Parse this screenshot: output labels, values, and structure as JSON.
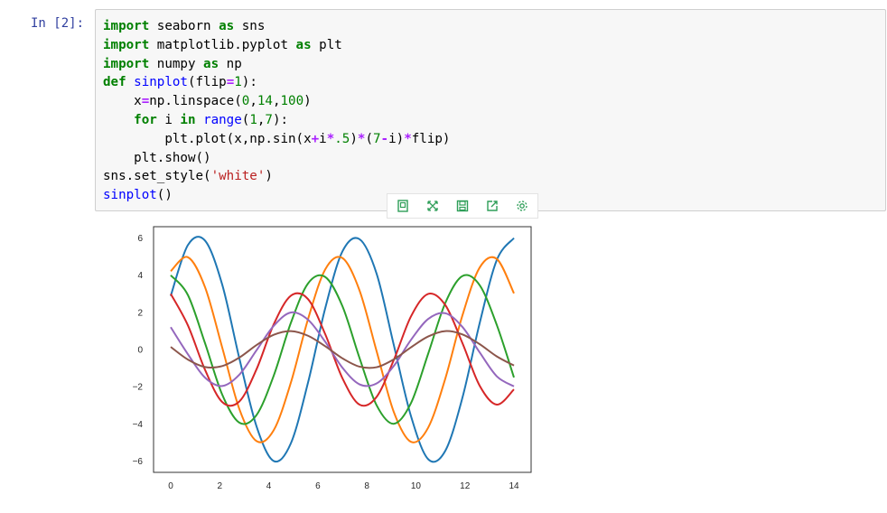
{
  "cell": {
    "prompt": "In [2]:",
    "code_lines": [
      "import seaborn as sns",
      "import matplotlib.pyplot as plt",
      "import numpy as np",
      "def sinplot(flip=1):",
      "    x=np.linspace(0,14,100)",
      "    for i in range(1,7):",
      "        plt.plot(x,np.sin(x+i*.5)*(7-i)*flip)",
      "    plt.show()",
      "sns.set_style('white')",
      "sinplot()"
    ]
  },
  "toolbar": {
    "icons": [
      "copy-icon",
      "expand-icon",
      "save-icon",
      "share-icon",
      "settings-icon"
    ],
    "color": "#2e9e58"
  },
  "chart_data": {
    "type": "line",
    "xlim": [
      -0.7,
      14.7
    ],
    "ylim": [
      -6.6,
      6.6
    ],
    "xticks": [
      0,
      2,
      4,
      6,
      8,
      10,
      12,
      14
    ],
    "yticks": [
      -6,
      -4,
      -2,
      0,
      2,
      4,
      6
    ],
    "grid": false,
    "x": [
      0,
      0.7,
      1.4,
      2.1,
      2.8,
      3.5,
      4.2,
      4.9,
      5.6,
      6.3,
      7.0,
      7.7,
      8.4,
      9.1,
      9.8,
      10.5,
      11.2,
      11.9,
      12.6,
      13.3,
      14.0
    ],
    "series": [
      {
        "color": "#1f77b4",
        "values": [
          2.88,
          5.61,
          5.85,
          3.49,
          -0.48,
          -4.13,
          -5.99,
          -5.04,
          -1.78,
          2.21,
          5.26,
          5.93,
          4.07,
          0.24,
          -3.58,
          -5.89,
          -5.44,
          -2.58,
          1.41,
          4.81,
          5.99
        ]
      },
      {
        "color": "#ff7f0e",
        "values": [
          4.21,
          4.96,
          3.35,
          0.11,
          -3.2,
          -4.92,
          -4.34,
          -1.78,
          1.63,
          4.3,
          4.92,
          3.18,
          -0.1,
          -3.36,
          -4.96,
          -4.2,
          -1.56,
          1.84,
          4.4,
          4.87,
          3.02
        ]
      },
      {
        "color": "#2ca02c",
        "values": [
          3.99,
          2.93,
          0.34,
          -2.42,
          -3.93,
          -3.52,
          -1.41,
          1.43,
          3.55,
          3.9,
          2.34,
          -0.45,
          -3.0,
          -3.99,
          -2.88,
          -0.23,
          2.5,
          3.95,
          3.46,
          1.32,
          -1.5
        ]
      },
      {
        "color": "#d62728",
        "values": [
          2.99,
          1.3,
          -1.09,
          -2.82,
          -2.79,
          -1.06,
          1.35,
          2.89,
          2.71,
          0.83,
          -1.53,
          -2.96,
          -2.54,
          -0.56,
          1.78,
          2.99,
          2.39,
          0.34,
          -1.94,
          -2.96,
          -2.14
        ]
      },
      {
        "color": "#9467bd",
        "values": [
          1.2,
          -0.25,
          -1.51,
          -1.96,
          -1.35,
          -0.04,
          1.27,
          1.99,
          1.6,
          0.42,
          -0.97,
          -1.87,
          -1.82,
          -0.88,
          0.52,
          1.64,
          1.95,
          1.21,
          -0.15,
          -1.44,
          -1.98
        ]
      },
      {
        "color": "#8c564b",
        "values": [
          0.14,
          -0.54,
          -0.94,
          -0.89,
          -0.43,
          0.24,
          0.79,
          0.99,
          0.74,
          0.18,
          -0.47,
          -0.92,
          -0.95,
          -0.53,
          0.12,
          0.7,
          0.99,
          0.81,
          0.29,
          -0.37,
          -0.86
        ]
      }
    ]
  }
}
